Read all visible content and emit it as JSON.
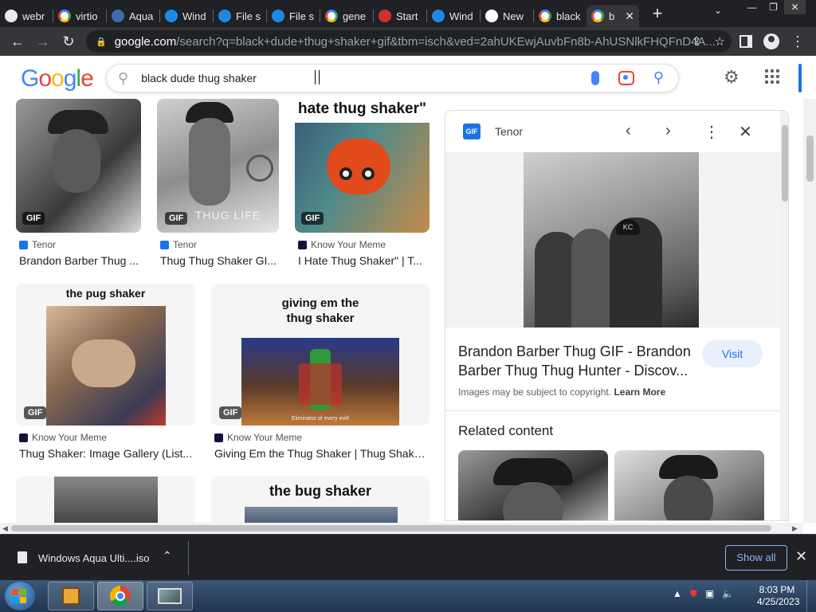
{
  "browser": {
    "tabs": [
      {
        "label": "webr",
        "icon": "wiki-icon",
        "color": "#e8eaed"
      },
      {
        "label": "virtio",
        "icon": "google-icon",
        "color": "#ffffff"
      },
      {
        "label": "Aqua",
        "icon": "aqua-icon",
        "color": "#3b6ea8"
      },
      {
        "label": "Wind",
        "icon": "edge-icon",
        "color": "#1e88e5"
      },
      {
        "label": "File s",
        "icon": "file-icon",
        "color": "#1e88e5"
      },
      {
        "label": "File s",
        "icon": "file-icon",
        "color": "#1e88e5"
      },
      {
        "label": "gene",
        "icon": "google-icon",
        "color": "#ffffff"
      },
      {
        "label": "Start",
        "icon": "m-icon",
        "color": "#d32f2f"
      },
      {
        "label": "Wind",
        "icon": "edge-icon",
        "color": "#1e88e5"
      },
      {
        "label": "New",
        "icon": "github-icon",
        "color": "#ffffff"
      },
      {
        "label": "black",
        "icon": "google-icon",
        "color": "#ffffff"
      },
      {
        "label": "b",
        "icon": "google-icon",
        "color": "#ffffff",
        "active": true
      }
    ],
    "new_tab_symbol": "+",
    "tab_search_symbol": "⌄",
    "url_host": "google.com",
    "url_path": "/search?q=black+dude+thug+shaker+gif&tbm=isch&ved=2ahUKEwjAuvbFn8b-AhUSNlkFHQFnD4A..."
  },
  "google": {
    "logo": [
      {
        "ch": "G",
        "color": "#4285f4"
      },
      {
        "ch": "o",
        "color": "#ea4335"
      },
      {
        "ch": "o",
        "color": "#fbbc05"
      },
      {
        "ch": "g",
        "color": "#4285f4"
      },
      {
        "ch": "l",
        "color": "#34a853"
      },
      {
        "ch": "e",
        "color": "#ea4335"
      }
    ],
    "search_query": "black dude thug shaker"
  },
  "results": {
    "row1": [
      {
        "source": "Tenor",
        "title": "Brandon Barber Thug ...",
        "badge": "GIF",
        "source_color": "#1a73e8"
      },
      {
        "source": "Tenor",
        "title": "Thug Thug Shaker GI...",
        "badge": "GIF",
        "overlay": "THUG LIFE",
        "source_color": "#1a73e8"
      },
      {
        "source": "Know Your Meme",
        "title": "I Hate Thug Shaker\" | T...",
        "badge": "GIF",
        "caption": "hate thug shaker\"",
        "source_color": "#13133a"
      }
    ],
    "row2": [
      {
        "source": "Know Your Meme",
        "title": "Thug Shaker: Image Gallery (List...",
        "badge": "GIF",
        "caption": "the pug shaker",
        "source_color": "#13133a"
      },
      {
        "source": "Know Your Meme",
        "title": "Giving Em the Thug Shaker | Thug Shake...",
        "badge": "GIF",
        "caption_line1": "giving em the",
        "caption_line2": "thug shaker",
        "sub": "Eliminator of every evil!",
        "source_color": "#13133a"
      }
    ],
    "row3": [
      {
        "caption": ""
      },
      {
        "caption": "the bug shaker"
      }
    ]
  },
  "panel": {
    "badge": "GIF",
    "source": "Tenor",
    "title": "Brandon Barber Thug GIF - Brandon Barber Thug Thug Hunter - Discov...",
    "visit_label": "Visit",
    "copyright": "Images may be subject to copyright.",
    "learn_more": "Learn More",
    "related_heading": "Related content",
    "image_cap_text": "KC"
  },
  "download": {
    "filename": "Windows Aqua Ulti....iso",
    "show_all": "Show all"
  },
  "taskbar": {
    "time": "8:03 PM",
    "date": "4/25/2023"
  }
}
